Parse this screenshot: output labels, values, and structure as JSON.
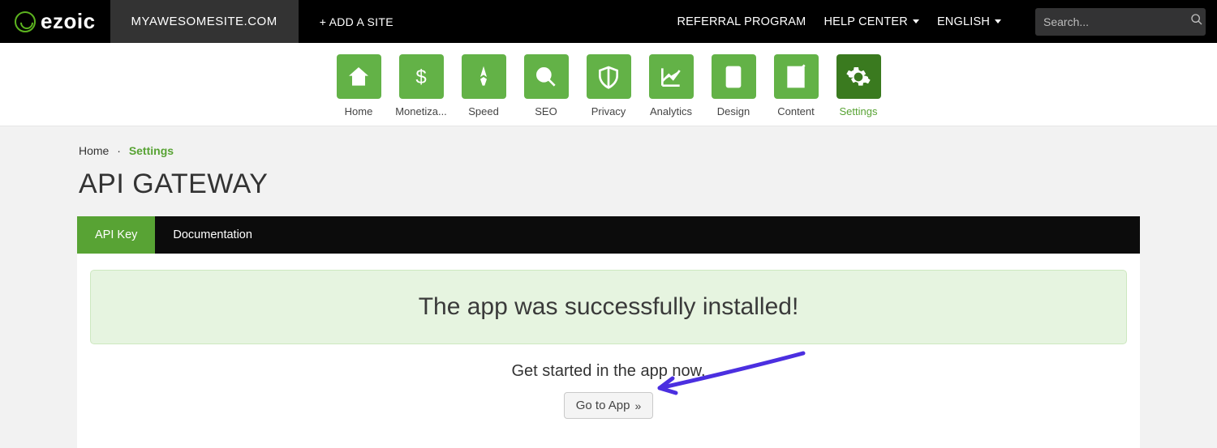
{
  "brand": {
    "word": "ezoic"
  },
  "topbar": {
    "site_tab": "MYAWESOMESITE.COM",
    "add_site": "+ ADD A SITE",
    "nav": {
      "referral": "REFERRAL PROGRAM",
      "help": "HELP CENTER",
      "lang": "ENGLISH"
    },
    "search_placeholder": "Search..."
  },
  "iconbar": {
    "home": "Home",
    "monetization": "Monetiza...",
    "speed": "Speed",
    "seo": "SEO",
    "privacy": "Privacy",
    "analytics": "Analytics",
    "design": "Design",
    "content": "Content",
    "settings": "Settings"
  },
  "breadcrumb": {
    "home": "Home",
    "current": "Settings"
  },
  "page": {
    "title": "API GATEWAY"
  },
  "tabs": {
    "api_key": "API Key",
    "documentation": "Documentation"
  },
  "panel": {
    "alert": "The app was successfully installed!",
    "helper": "Get started in the app now.",
    "cta": "Go to App"
  }
}
